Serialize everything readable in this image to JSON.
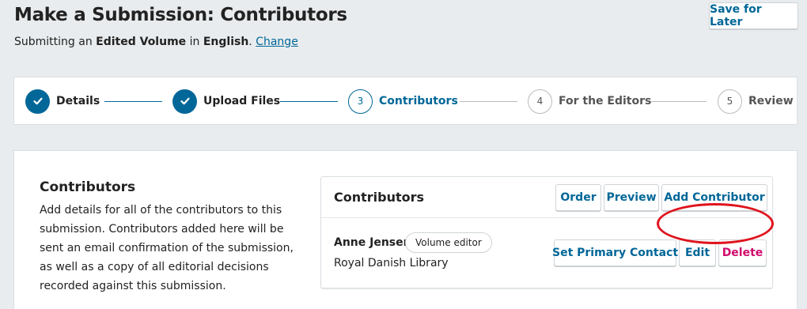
{
  "header": {
    "title": "Make a Submission: Contributors",
    "subtitle_prefix": "Submitting an ",
    "subtitle_type": "Edited Volume",
    "subtitle_mid": " in ",
    "subtitle_language": "English",
    "subtitle_suffix": ". ",
    "change_link": "Change",
    "save_later_label": "Save for Later"
  },
  "steps": [
    {
      "number": "",
      "label": "Details",
      "state": "done"
    },
    {
      "number": "",
      "label": "Upload Files",
      "state": "done"
    },
    {
      "number": "3",
      "label": "Contributors",
      "state": "current"
    },
    {
      "number": "4",
      "label": "For the Editors",
      "state": "todo"
    },
    {
      "number": "5",
      "label": "Review",
      "state": "todo"
    }
  ],
  "section": {
    "heading": "Contributors",
    "description": "Add details for all of the contributors to this submission. Contributors added here will be sent an email confirmation of the submission, as well as a copy of all editorial decisions recorded against this submission."
  },
  "panel": {
    "title": "Contributors",
    "order_label": "Order",
    "preview_label": "Preview",
    "add_label": "Add Contributor",
    "contributors": [
      {
        "name": "Anne Jensen",
        "role": "Volume editor",
        "affiliation": "Royal Danish Library",
        "set_primary_label": "Set Primary Contact",
        "edit_label": "Edit",
        "delete_label": "Delete"
      }
    ]
  },
  "colors": {
    "accent": "#006798",
    "danger": "#d00a6c",
    "annotation": "#e0131d"
  }
}
